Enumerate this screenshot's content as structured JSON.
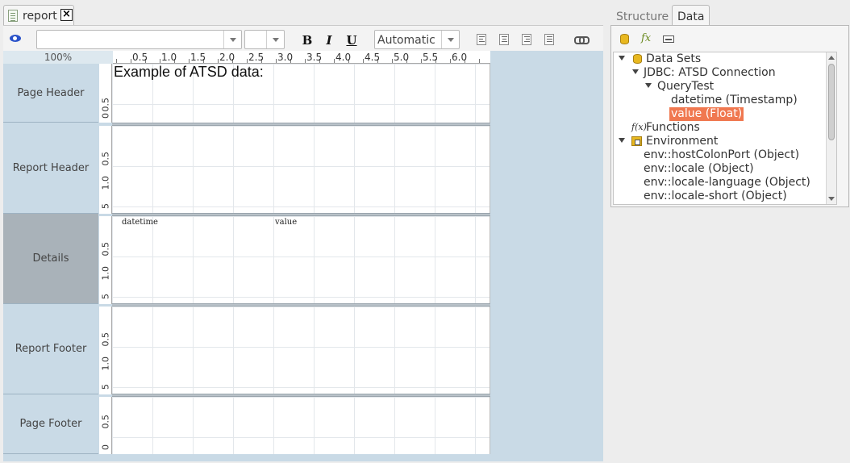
{
  "editor": {
    "tab_label": "report",
    "zoom": "100%",
    "ruler_ticks": [
      "0.5",
      "1.0",
      "1.5",
      "2.0",
      "2.5",
      "3.0",
      "3.5",
      "4.0",
      "4.5",
      "5.0",
      "5.5",
      "6.0"
    ]
  },
  "toolbar": {
    "font_value": "",
    "size_value": "",
    "bold": "B",
    "italic": "I",
    "underline": "U",
    "color_value": "Automatic"
  },
  "bands": [
    {
      "label": "Page Header",
      "ruler": [
        "0",
        "0.5"
      ]
    },
    {
      "label": "Report Header",
      "ruler": [
        "5",
        "1.0",
        "0.5"
      ]
    },
    {
      "label": "Details",
      "ruler": [
        "5",
        "1.0",
        "0.5"
      ]
    },
    {
      "label": "Report Footer",
      "ruler": [
        "5",
        "1.0",
        "0.5"
      ]
    },
    {
      "label": "Page Footer",
      "ruler": [
        "0",
        "0.5"
      ]
    }
  ],
  "report": {
    "title": "Example of ATSD data:",
    "fields": [
      "datetime",
      "value"
    ]
  },
  "panel": {
    "tabs": [
      "Structure",
      "Data"
    ],
    "active_tab": "Data",
    "tree": [
      {
        "label": "Data Sets",
        "level": 0,
        "expanded": true,
        "icon": "database-icon"
      },
      {
        "label": "JDBC: ATSD Connection",
        "level": 1,
        "expanded": true,
        "icon": ""
      },
      {
        "label": "QueryTest",
        "level": 2,
        "expanded": true,
        "icon": ""
      },
      {
        "label": "datetime (Timestamp)",
        "level": 3,
        "icon": ""
      },
      {
        "label": "value (Float)",
        "level": 3,
        "icon": "",
        "selected": true
      },
      {
        "label": "Functions",
        "level": 0,
        "icon": "function-icon"
      },
      {
        "label": "Environment",
        "level": 0,
        "expanded": true,
        "icon": "environment-icon"
      },
      {
        "label": "env::hostColonPort (Object)",
        "level": 1,
        "icon": ""
      },
      {
        "label": "env::locale (Object)",
        "level": 1,
        "icon": ""
      },
      {
        "label": "env::locale-language (Object)",
        "level": 1,
        "icon": ""
      },
      {
        "label": "env::locale-short (Object)",
        "level": 1,
        "icon": ""
      }
    ]
  }
}
